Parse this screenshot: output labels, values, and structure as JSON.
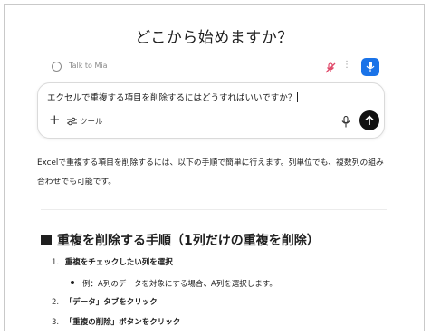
{
  "page": {
    "heading": "どこから始めますか？"
  },
  "assistant_bar": {
    "label": "Talk to Mia",
    "mic_off_icon": "mic-off-icon",
    "menu_glyph": "⋮",
    "voice_icon": "microphone-icon",
    "accent": "#1a73e8"
  },
  "composer": {
    "query": "エクセルで重複する項目を削除するにはどうすればいいですか？",
    "plus_glyph": "+",
    "tools_label": "ツール",
    "tools_icon": "sliders-icon",
    "mic_icon": "microphone-icon",
    "send_icon": "arrow-up-icon"
  },
  "answer": {
    "intro": "Excelで重複する項目を削除するには、以下の手順で簡単に行えます。列単位でも、複数列の組み合わせでも可能です。",
    "section_title": "重複を削除する手順（1列だけの重複を削除）",
    "steps": [
      {
        "num": "1.",
        "text": "重複をチェックしたい列を選択"
      },
      {
        "num": "2.",
        "text": "「データ」タブをクリック"
      },
      {
        "num": "3.",
        "text": "「重複の削除」ボタンをクリック"
      }
    ],
    "sub_bullet": "例：A列のデータを対象にする場合、A列を選択します。"
  }
}
